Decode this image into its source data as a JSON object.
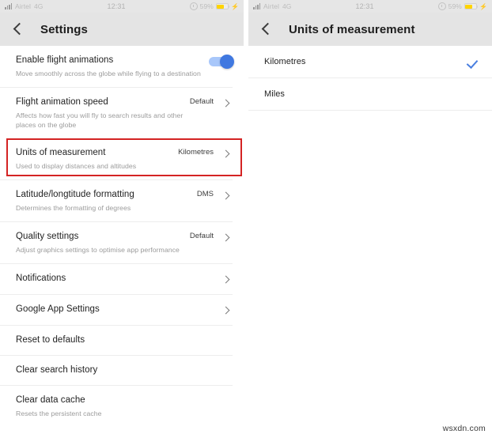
{
  "status_bar": {
    "carrier": "Airtel",
    "network_type": "4G",
    "time": "12:31",
    "battery_percent": "59%",
    "battery_level": 59,
    "alarm_icon": "alarm-icon",
    "signal_icon": "signal-bars-icon",
    "battery_icon": "battery-icon",
    "charging_icon": "bolt-icon"
  },
  "colors": {
    "accent_blue": "#4078e0",
    "toggle_track": "#a8c7fa",
    "highlight_red": "#d42323",
    "battery_yellow": "#ffd400",
    "appbar_gray": "#e4e4e4",
    "statusbar_gray": "#e6e6e6"
  },
  "left_screen": {
    "appbar": {
      "back_icon": "back-chevron-icon",
      "title": "Settings"
    },
    "rows": [
      {
        "title": "Enable flight animations",
        "subtitle": "Move smoothly across the globe while flying to a destination",
        "control": "toggle",
        "toggle_on": true,
        "value": "",
        "has_chevron": false,
        "highlighted": false
      },
      {
        "title": "Flight animation speed",
        "subtitle": "Affects how fast you will fly to search results and other places on the globe",
        "control": "chevron",
        "value": "Default",
        "has_chevron": true,
        "highlighted": false
      },
      {
        "title": "Units of measurement",
        "subtitle": "Used to display distances and altitudes",
        "control": "chevron",
        "value": "Kilometres",
        "has_chevron": true,
        "highlighted": true
      },
      {
        "title": "Latitude/longtitude formatting",
        "subtitle": "Determines the formatting of degrees",
        "control": "chevron",
        "value": "DMS",
        "has_chevron": true,
        "highlighted": false
      },
      {
        "title": "Quality settings",
        "subtitle": "Adjust graphics settings to optimise app performance",
        "control": "chevron",
        "value": "Default",
        "has_chevron": true,
        "highlighted": false
      },
      {
        "title": "Notifications",
        "subtitle": "",
        "control": "chevron",
        "value": "",
        "has_chevron": true,
        "highlighted": false
      },
      {
        "title": "Google App Settings",
        "subtitle": "",
        "control": "chevron",
        "value": "",
        "has_chevron": true,
        "highlighted": false
      },
      {
        "title": "Reset to defaults",
        "subtitle": "",
        "control": "none",
        "value": "",
        "has_chevron": false,
        "highlighted": false
      },
      {
        "title": "Clear search history",
        "subtitle": "",
        "control": "none",
        "value": "",
        "has_chevron": false,
        "highlighted": false
      },
      {
        "title": "Clear data cache",
        "subtitle": "Resets the persistent cache",
        "control": "none",
        "value": "",
        "has_chevron": false,
        "highlighted": false
      }
    ]
  },
  "right_screen": {
    "appbar": {
      "back_icon": "back-chevron-icon",
      "title": "Units of measurement"
    },
    "options": [
      {
        "label": "Kilometres",
        "selected": true,
        "check_icon": "check-icon"
      },
      {
        "label": "Miles",
        "selected": false,
        "check_icon": ""
      }
    ]
  },
  "watermark": "wsxdn.com"
}
